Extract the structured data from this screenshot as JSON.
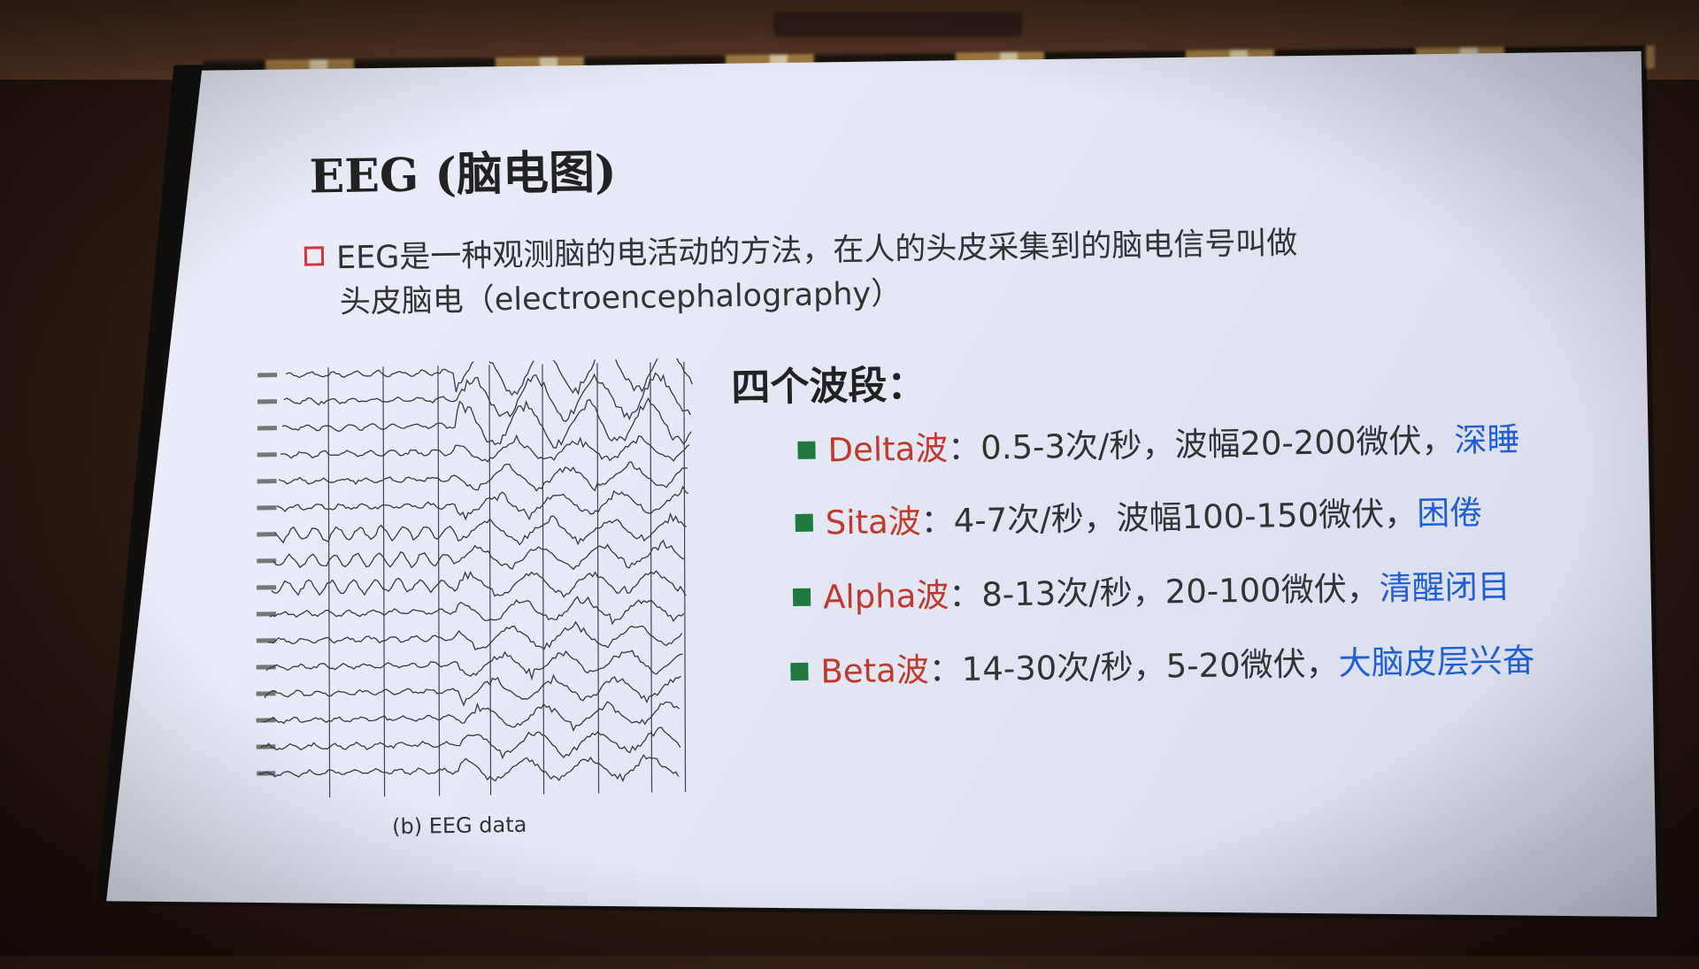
{
  "slide": {
    "title": "EEG (脑电图)",
    "intro": {
      "line1": "EEG是一种观测脑的电活动的方法，在人的头皮采集到的脑电信号叫做",
      "line2": "头皮脑电（electroencephalography）"
    },
    "figure_caption": "(b) EEG data",
    "bands_title": "四个波段：",
    "bands": [
      {
        "name": "Delta波",
        "desc": "：0.5-3次/秒，波幅20-200微伏，",
        "state": "深睡"
      },
      {
        "name": "Sita波",
        "desc": "：4-7次/秒，波幅100-150微伏，",
        "state": "困倦"
      },
      {
        "name": "Alpha波",
        "desc": "：8-13次/秒，20-100微伏，",
        "state": "清醒闭目"
      },
      {
        "name": "Beta波",
        "desc": "：14-30次/秒，5-20微伏，",
        "state": "大脑皮层兴奋"
      }
    ]
  },
  "colors": {
    "band_name": "#c0392b",
    "band_state": "#1f5fd6",
    "bullet_square": "#1f7a3f",
    "intro_bullet": "#d9313a"
  },
  "icons": {
    "intro_bullet": "hollow-square-icon",
    "band_bullet": "filled-square-icon"
  }
}
